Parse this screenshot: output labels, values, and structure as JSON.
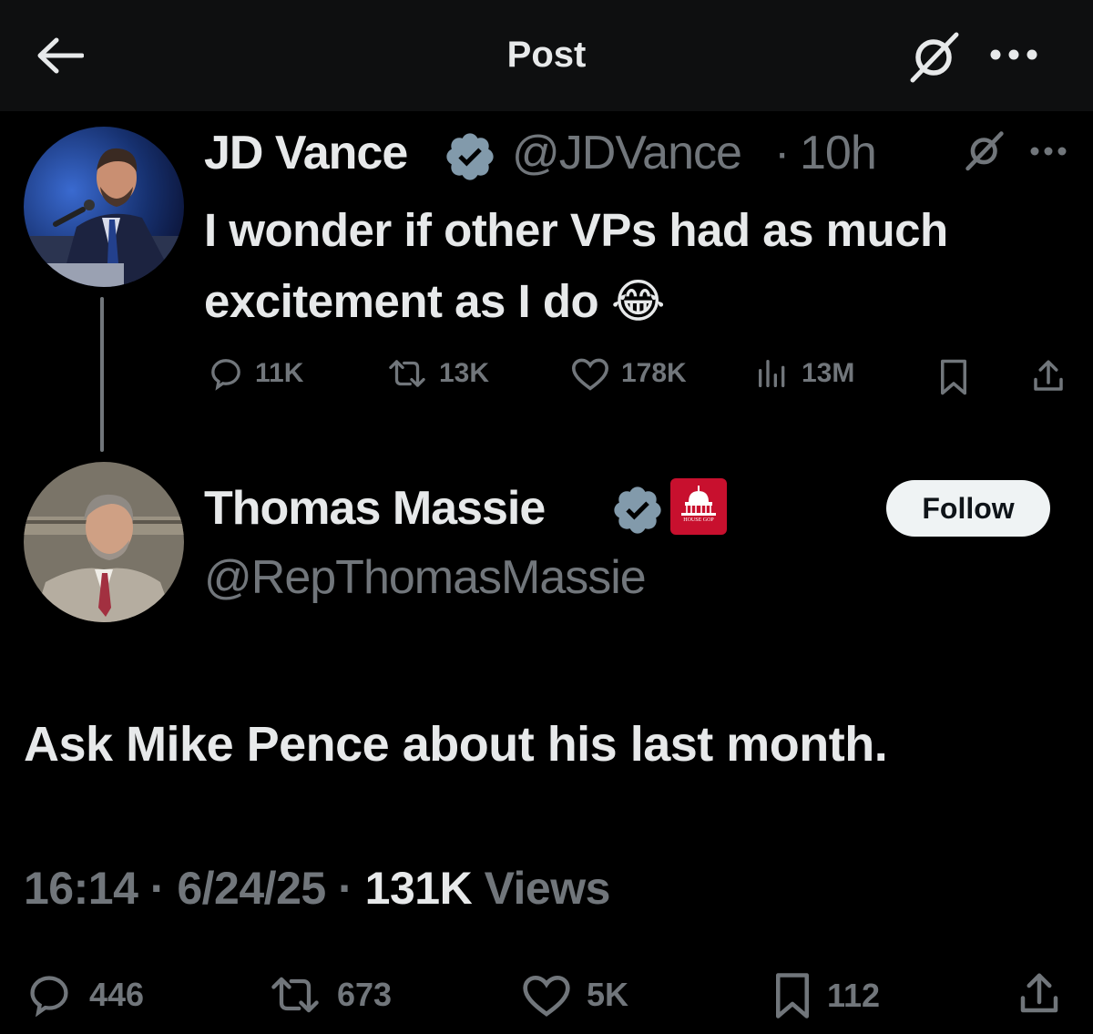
{
  "header": {
    "title": "Post",
    "back_icon": "arrow-left-icon",
    "grok_icon": "grok-icon",
    "more_icon": "more-dots-icon"
  },
  "parent_post": {
    "author_name": "JD Vance",
    "author_handle": "@JDVance",
    "separator": "·",
    "time": "10h",
    "verified": true,
    "text": "I wonder if other VPs had as much excitement as I do 😂",
    "stats": {
      "replies": "11K",
      "reposts": "13K",
      "likes": "178K",
      "views": "13M"
    }
  },
  "reply_post": {
    "author_name": "Thomas Massie",
    "author_handle": "@RepThomasMassie",
    "verified": true,
    "affiliation_badge": "HOUSE GOP",
    "follow_label": "Follow",
    "text": "Ask Mike Pence about his last month.",
    "meta": {
      "time": "16:14",
      "date": "6/24/25",
      "separator": "·",
      "views_count": "131K",
      "views_label": "Views"
    },
    "stats": {
      "replies": "446",
      "reposts": "673",
      "likes": "5K",
      "bookmarks": "112"
    }
  },
  "colors": {
    "background": "#000000",
    "header_bg": "#0e0f10",
    "text_primary": "#e7e9ea",
    "text_secondary": "#71767b",
    "verified_badge": "#829aab",
    "gop_badge": "#c8102e"
  }
}
